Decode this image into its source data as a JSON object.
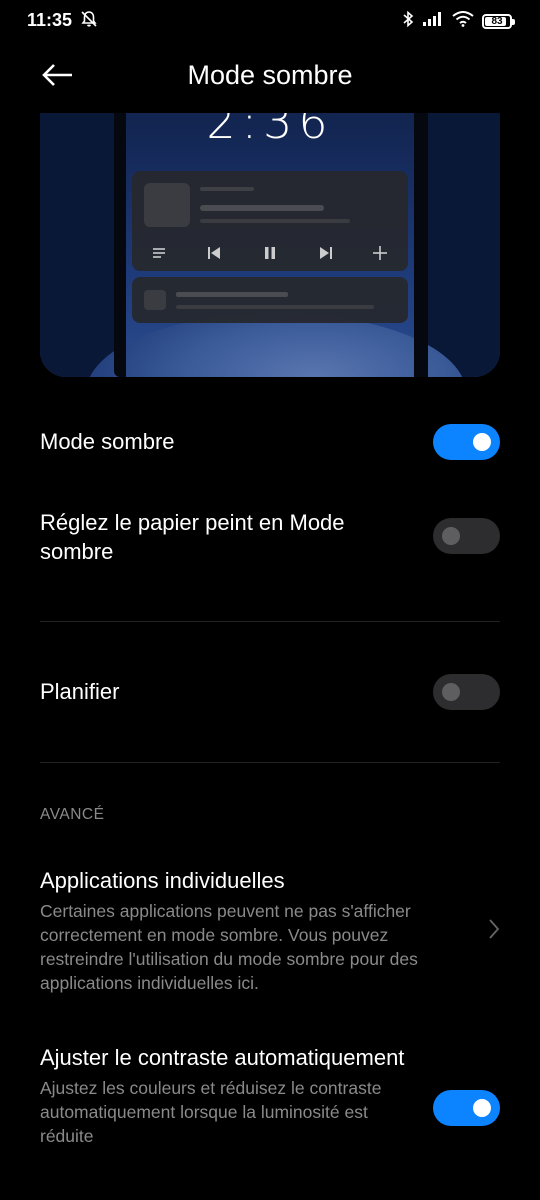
{
  "status_bar": {
    "time": "11:35",
    "battery": "83",
    "icons": [
      "mute-bell-icon",
      "bluetooth-icon",
      "signal-icon",
      "wifi-icon",
      "battery-icon"
    ]
  },
  "header": {
    "title": "Mode sombre",
    "back_icon": "arrow-left-icon"
  },
  "preview": {
    "clock": "2:36"
  },
  "settings": {
    "dark_mode": {
      "label": "Mode sombre",
      "enabled": true
    },
    "wallpaper": {
      "label": "Réglez le papier peint en Mode sombre",
      "enabled": false
    },
    "schedule": {
      "label": "Planifier",
      "enabled": false
    }
  },
  "advanced": {
    "section_title": "AVANCÉ",
    "individual_apps": {
      "label": "Applications individuelles",
      "description": "Certaines applications peuvent ne pas s'afficher correctement en mode sombre. Vous pouvez restreindre l'utilisation du mode sombre pour des applications individuelles ici."
    },
    "auto_contrast": {
      "label": "Ajuster le contraste automatiquement",
      "description": "Ajustez les couleurs et réduisez le contraste automatiquement lorsque la luminosité est réduite",
      "enabled": true
    }
  },
  "colors": {
    "background": "#000000",
    "accent": "#0d84ff",
    "secondary_text": "#8a8a8a"
  }
}
